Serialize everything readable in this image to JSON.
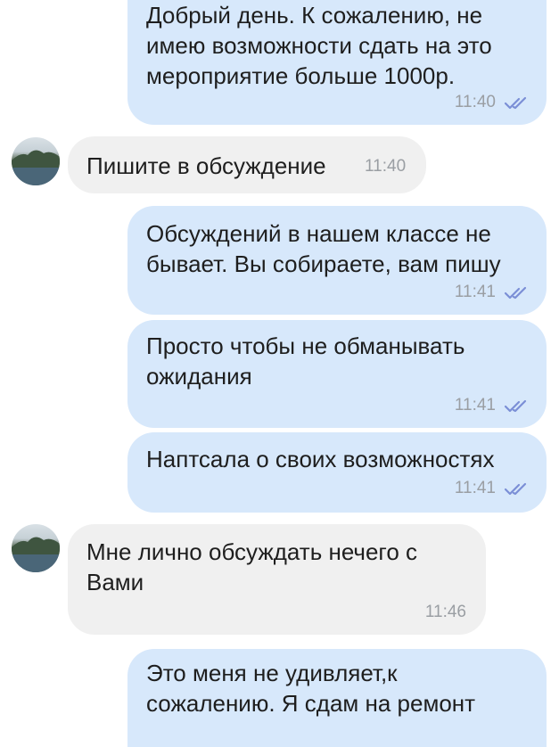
{
  "messages": [
    {
      "text": "Добрый день. К сожалению, не\nимею возможности сдать на это\nмероприятие больше 1000р.",
      "time": "11:40",
      "direction": "out"
    },
    {
      "text": "Пишите в обсуждение",
      "time": "11:40",
      "direction": "in"
    },
    {
      "text": "Обсуждений в нашем классе не\nбывает. Вы собираете, вам пишу",
      "time": "11:41",
      "direction": "out"
    },
    {
      "text": "Просто чтобы не обманывать\nожидания",
      "time": "11:41",
      "direction": "out"
    },
    {
      "text": "Наптсала о своих возможностях",
      "time": "11:41",
      "direction": "out"
    },
    {
      "text": "Мне лично обсуждать нечего с\nВами",
      "time": "11:46",
      "direction": "in"
    },
    {
      "text": "Это меня не удивляет,к\nсожалению. Я сдам на ремонт",
      "time": "",
      "direction": "out"
    }
  ],
  "colors": {
    "outgoing_bubble": "#d7e8fb",
    "incoming_bubble": "#f0f0f0",
    "read_check": "#7b8fd6",
    "time_text": "#9a9ea3"
  },
  "icons": {
    "read_status": "double-check-icon",
    "avatar": "landscape-avatar-icon"
  }
}
